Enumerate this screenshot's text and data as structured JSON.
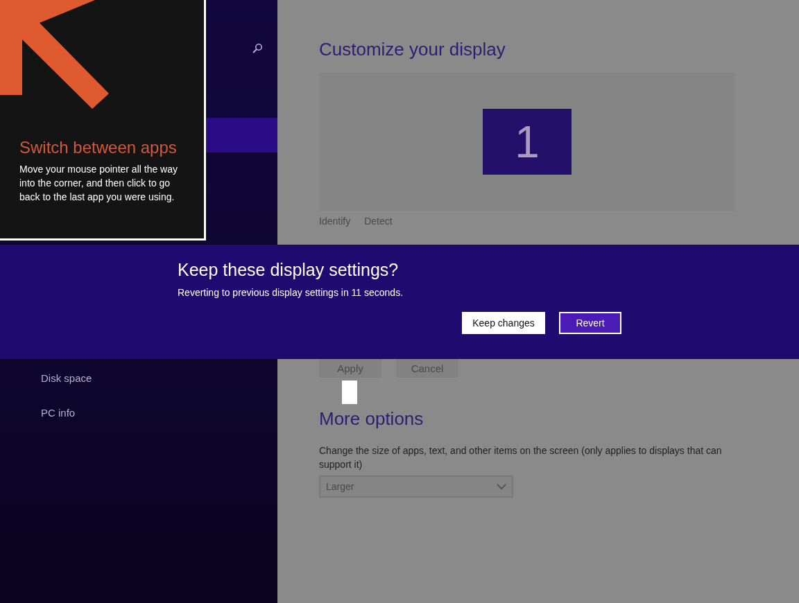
{
  "tip": {
    "title": "Switch between apps",
    "body": "Move your mouse pointer all the way into the corner, and then click to go back to the last app you were using."
  },
  "sidebar": {
    "items": [
      {
        "selected": true
      },
      {
        "label": "Disk space",
        "selected": false
      },
      {
        "label": "PC info",
        "selected": false
      }
    ]
  },
  "display": {
    "title": "Customize your display",
    "monitor_number": "1",
    "links": [
      "Identify",
      "Detect"
    ]
  },
  "dialog": {
    "title": "Keep these display settings?",
    "message": "Reverting to previous display settings in 11 seconds.",
    "buttons": [
      {
        "label": "Keep changes",
        "kind": "secondary"
      },
      {
        "label": "Revert",
        "kind": "primary"
      }
    ]
  },
  "actions": [
    {
      "label": "Apply",
      "disabled": true
    },
    {
      "label": "Cancel",
      "disabled": true
    }
  ],
  "more_options": {
    "title": "More options",
    "description": "Change the size of apps, text, and other items on the screen (only applies to displays that can support it)",
    "dropdown": {
      "value": "Larger",
      "disabled": true
    }
  }
}
